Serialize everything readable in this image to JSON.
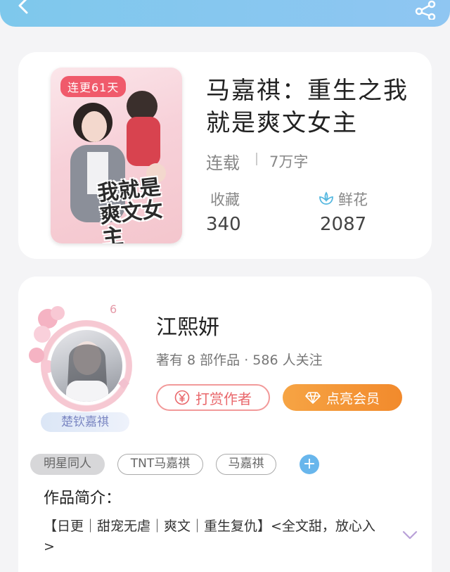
{
  "book": {
    "update_badge": "连更61天",
    "cover_title": "我就是爽文女主",
    "title": "马嘉祺：重生之我就是爽文女主",
    "status": "连载",
    "word_count": "7万字",
    "favorites_label": "收藏",
    "favorites_value": "340",
    "flowers_label": "鲜花",
    "flowers_value": "2087"
  },
  "author": {
    "frame_name": "楚钦嘉祺",
    "name": "江熙妍",
    "meta": "著有 8 部作品 · 586 人关注",
    "tip_label": "打赏作者",
    "vip_label": "点亮会员"
  },
  "tags": [
    "明星同人",
    "TNT马嘉祺",
    "马嘉祺"
  ],
  "intro": {
    "title": "作品简介：",
    "text": "【日更｜甜宠无虐｜爽文｜重生复仇】<全文甜，放心入>"
  },
  "icons": {
    "back": "chevron-left-icon",
    "share": "share-icon",
    "flower": "flower-icon",
    "yen": "yen-icon",
    "diamond": "diamond-icon",
    "expand": "chevron-down-icon"
  },
  "colors": {
    "header": "#8fc6f2",
    "badge": "#f05a6b",
    "tip_border": "#f29a9a",
    "vip": "#f28a2c",
    "tag_add": "#68b6ec"
  }
}
